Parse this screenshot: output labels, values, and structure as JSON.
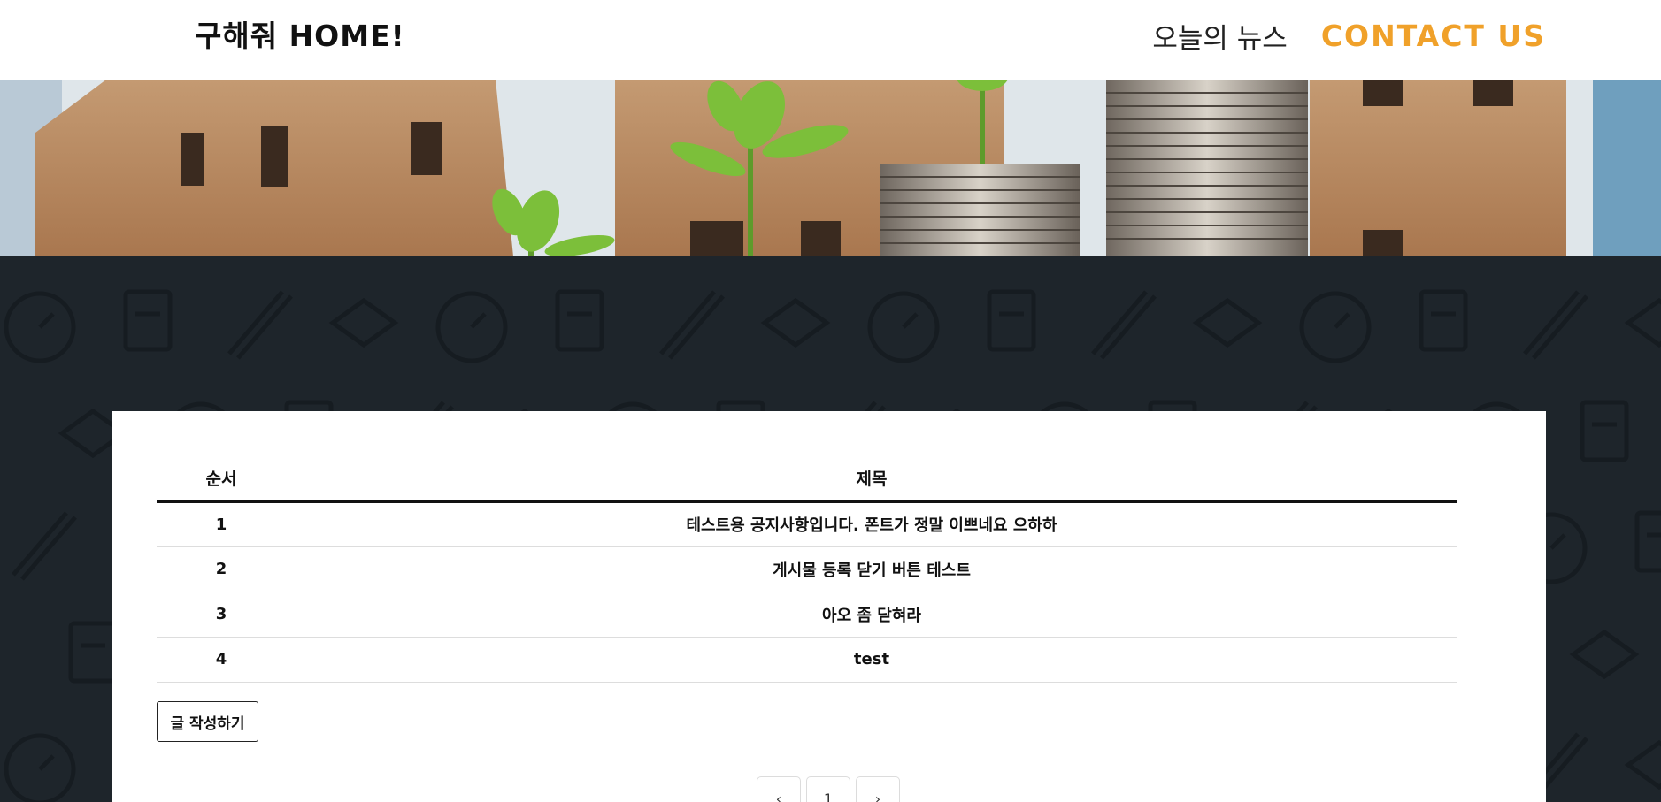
{
  "header": {
    "brand": "구해줘 HOME!",
    "nav": [
      {
        "label": "오늘의 뉴스"
      },
      {
        "label": "CONTACT US"
      }
    ]
  },
  "colors": {
    "accent": "#f0a12a",
    "dark_bg": "#1e252b",
    "card_bg": "#ffffff"
  },
  "hero": {
    "image": "houses-coins-plants-image"
  },
  "board": {
    "columns": [
      "순서",
      "제목"
    ],
    "rows": [
      {
        "no": "1",
        "title": "테스트용 공지사항입니다. 폰트가 정말 이쁘네요 으하하"
      },
      {
        "no": "2",
        "title": "게시물 등록 닫기 버튼 테스트"
      },
      {
        "no": "3",
        "title": "아오 좀 닫혀라"
      },
      {
        "no": "4",
        "title": "test"
      }
    ],
    "write_button": "글 작성하기"
  },
  "pagination": {
    "prev_icon": "chevron-left-icon",
    "current": "1",
    "next_icon": "chevron-right-icon"
  }
}
